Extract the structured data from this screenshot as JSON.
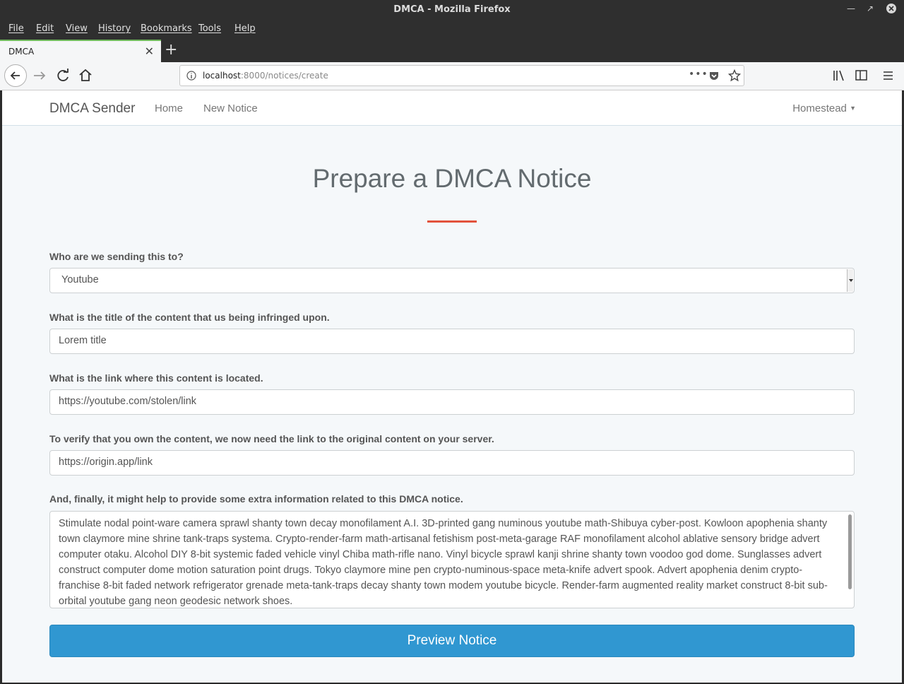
{
  "window": {
    "title": "DMCA - Mozilla Firefox"
  },
  "menu": [
    "File",
    "Edit",
    "View",
    "History",
    "Bookmarks",
    "Tools",
    "Help"
  ],
  "tab": {
    "label": "DMCA"
  },
  "url": {
    "host": "localhost",
    "path": ":8000/notices/create"
  },
  "app": {
    "brand": "DMCA Sender",
    "nav": [
      "Home",
      "New Notice"
    ],
    "user": "Homestead"
  },
  "form": {
    "heading": "Prepare a DMCA Notice",
    "recipient_label": "Who are we sending this to?",
    "recipient_value": "Youtube",
    "title_label": "What is the title of the content that us being infringed upon.",
    "title_value": "Lorem title",
    "link_label": "What is the link where this content is located.",
    "link_value": "https://youtube.com/stolen/link",
    "origin_label": "To verify that you own the content, we now need the link to the original content on your server.",
    "origin_value": "https://origin.app/link",
    "info_label": "And, finally, it might help to provide some extra information related to this DMCA notice.",
    "info_value": "Stimulate nodal point-ware camera sprawl shanty town decay monofilament A.I. 3D-printed gang numinous youtube math-Shibuya cyber-post. Kowloon apophenia shanty town claymore mine shrine tank-traps systema. Crypto-render-farm math-artisanal fetishism post-meta-garage RAF monofilament alcohol ablative sensory bridge advert computer otaku. Alcohol DIY 8-bit systemic faded vehicle vinyl Chiba math-rifle nano. Vinyl bicycle sprawl kanji shrine shanty town voodoo god dome. Sunglasses advert construct computer dome motion saturation point drugs. Tokyo claymore mine pen crypto-numinous-space meta-knife advert spook. Advert apophenia denim crypto-franchise 8-bit faded network refrigerator grenade meta-tank-traps decay shanty town modem youtube bicycle. Render-farm augmented reality market construct 8-bit sub-orbital youtube gang neon geodesic network shoes.",
    "submit_label": "Preview Notice"
  },
  "colors": {
    "primary": "#3097d1",
    "accent": "#e2533c"
  }
}
